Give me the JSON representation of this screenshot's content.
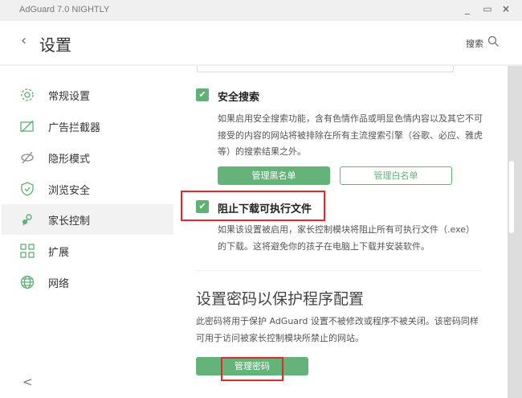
{
  "window": {
    "title": "AdGuard 7.0 NIGHTLY",
    "minimize": "_",
    "maximize": "▭",
    "close": "×"
  },
  "header": {
    "title": "设置",
    "search_label": "搜索"
  },
  "sidebar": {
    "items": [
      {
        "label": "常规设置",
        "icon": "gear-icon"
      },
      {
        "label": "广告拦截器",
        "icon": "ad-block-icon"
      },
      {
        "label": "隐形模式",
        "icon": "eye-off-icon"
      },
      {
        "label": "浏览安全",
        "icon": "shield-icon"
      },
      {
        "label": "家长控制",
        "icon": "parental-icon",
        "active": true
      },
      {
        "label": "扩展",
        "icon": "grid-icon"
      },
      {
        "label": "网络",
        "icon": "globe-icon"
      }
    ],
    "collapse": "<"
  },
  "content": {
    "safe_search": {
      "label": "安全搜索",
      "checked": true,
      "description": "如果启用安全搜索功能，含有色情作品或明显色情内容以及其它不可接受的内容的网站将被排除在所有主流搜索引擎（谷歌、必应、雅虎等）的搜索结果之外。",
      "blacklist_button": "管理黑名单",
      "whitelist_button": "管理白名单"
    },
    "block_exe": {
      "label": "阻止下载可执行文件",
      "checked": true,
      "description": "如果该设置被启用，家长控制模块将阻止所有可执行文件（.exe）的下载。这将避免你的孩子在电脑上下载并安装软件。"
    },
    "password": {
      "heading": "设置密码以保护程序配置",
      "description": "此密码将用于保护 AdGuard 设置不被修改或程序不被关闭。该密码同样可用于访问被家长控制模块所禁止的网站。",
      "button": "管理密码"
    }
  },
  "colors": {
    "accent": "#66b27b",
    "highlight": "#e8262b"
  }
}
